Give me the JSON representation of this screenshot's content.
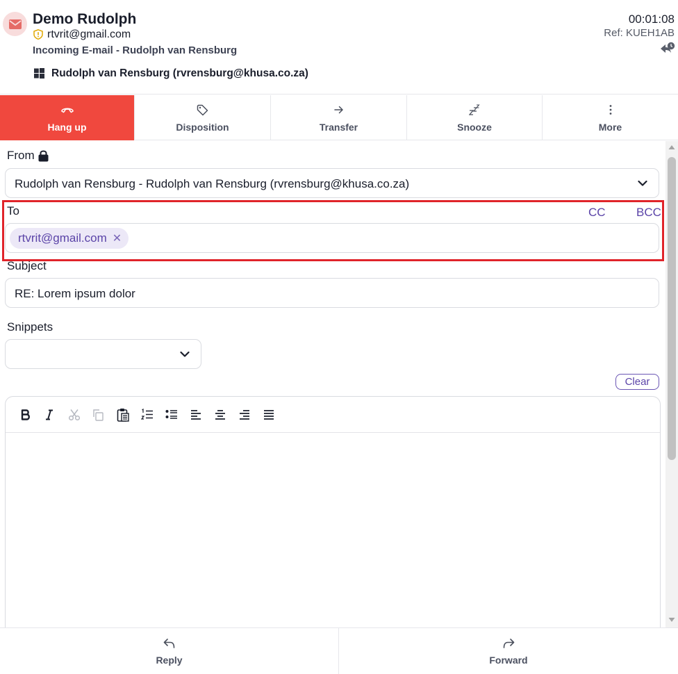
{
  "header": {
    "contact_name": "Demo Rudolph",
    "contact_email": "rtvrit@gmail.com",
    "subtitle": "Incoming E-mail - Rudolph van Rensburg",
    "mailbox": "Rudolph van Rensburg (rvrensburg@khusa.co.za)",
    "timer": "00:01:08",
    "ref": "Ref: KUEH1AB",
    "colors": {
      "avatar_bg": "#f8dcdc",
      "avatar_icon": "#e56b66",
      "shield": "#e0a800"
    }
  },
  "actions": [
    {
      "label": "Hang up",
      "icon": "hang-up-icon"
    },
    {
      "label": "Disposition",
      "icon": "tag-icon"
    },
    {
      "label": "Transfer",
      "icon": "arrow-right-icon"
    },
    {
      "label": "Snooze",
      "icon": "snooze-icon"
    },
    {
      "label": "More",
      "icon": "more-vertical-icon"
    }
  ],
  "form": {
    "from_label": "From",
    "from_value": "Rudolph van Rensburg - Rudolph van Rensburg (rvrensburg@khusa.co.za)",
    "to_label": "To",
    "cc_label": "CC",
    "bcc_label": "BCC",
    "to_recipients": [
      "rtvrit@gmail.com"
    ],
    "subject_label": "Subject",
    "subject_value": "RE: Lorem ipsum dolor",
    "snippets_label": "Snippets",
    "snippets_value": "",
    "clear_label": "Clear"
  },
  "editor_toolbar": [
    "bold-icon",
    "italic-icon",
    "cut-icon",
    "copy-icon",
    "paste-icon",
    "ordered-list-icon",
    "unordered-list-icon",
    "align-left-icon",
    "align-center-icon",
    "align-right-icon",
    "align-justify-icon"
  ],
  "bottom": {
    "reply_label": "Reply",
    "forward_label": "Forward"
  },
  "colors": {
    "hang_up_bg": "#f0483e",
    "accent_purple": "#5b44a8",
    "highlight_red": "#e0242a"
  }
}
